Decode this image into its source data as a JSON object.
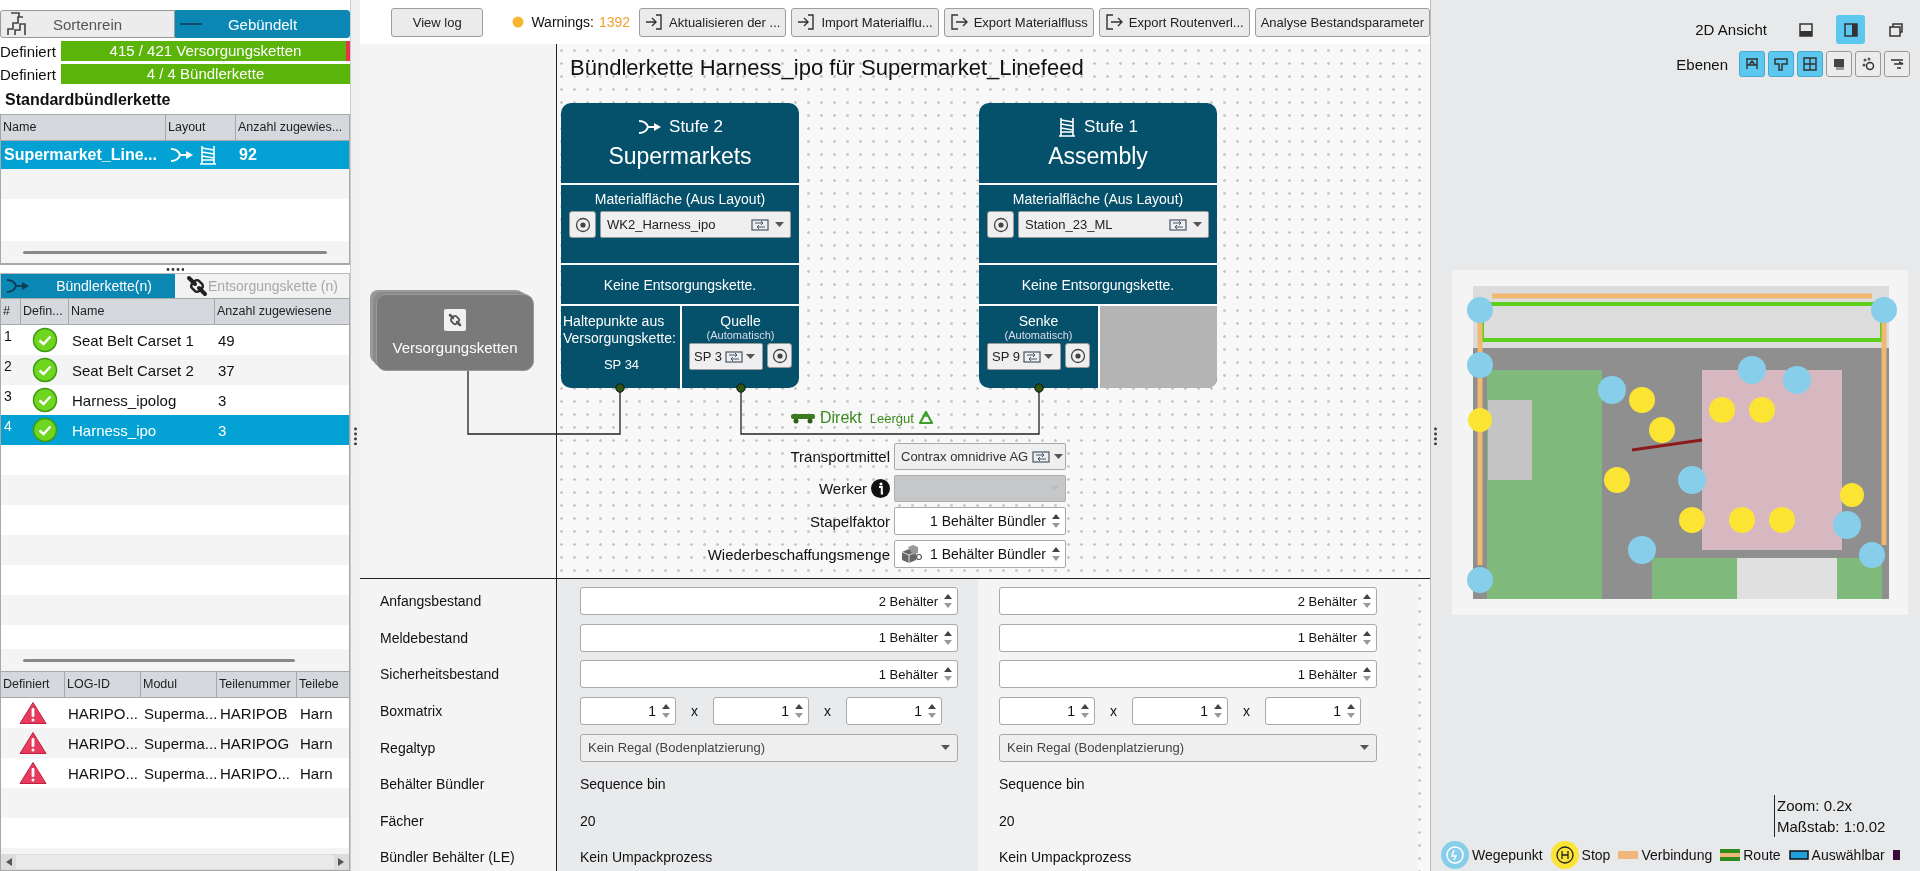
{
  "mode_toggle": [
    {
      "label": "Sortenrein",
      "selected": false
    },
    {
      "label": "Gebündelt",
      "selected": true
    }
  ],
  "progress": [
    {
      "label": "Definiert",
      "text": "415 / 421 Versorgungsketten",
      "level": 0.986
    },
    {
      "label": "Definiert",
      "text": "4 / 4 Bündlerkette",
      "level": 1
    }
  ],
  "default_chain": {
    "title": "Standardbündlerkette",
    "columns": [
      "Name",
      "Layout",
      "Anzahl zugewies..."
    ],
    "rows": [
      {
        "name": "Supermarket_Line...",
        "count": "92",
        "selected": true
      }
    ]
  },
  "chain_tabs": [
    {
      "label": "Bündlerkette(n)",
      "selected": true,
      "disabled": false
    },
    {
      "label": "Entsorgungskette (n)",
      "selected": false,
      "disabled": true
    }
  ],
  "chains": {
    "columns": [
      "#",
      "Defin...",
      "Name",
      "Anzahl zugewiesene"
    ],
    "rows": [
      {
        "index": "1",
        "defined": true,
        "name": "Seat Belt Carset 1",
        "count": "49",
        "selected": false
      },
      {
        "index": "2",
        "defined": true,
        "name": "Seat Belt Carset 2",
        "count": "37",
        "selected": false
      },
      {
        "index": "3",
        "defined": true,
        "name": "Harness_ipolog",
        "count": "3",
        "selected": false
      },
      {
        "index": "4",
        "defined": true,
        "name": "Harness_ipo",
        "count": "3",
        "selected": true
      }
    ]
  },
  "parts": {
    "columns": [
      "Definiert",
      "LOG-ID",
      "Modul",
      "Teilenummer",
      "Teilebe"
    ],
    "rows": [
      {
        "defined": false,
        "log_id": "HARIPO...",
        "module": "Superma...",
        "part_number": "HARIPOB",
        "column_5": "Harn"
      },
      {
        "defined": false,
        "log_id": "HARIPO...",
        "module": "Superma...",
        "part_number": "HARIPOG",
        "column_5": "Harn"
      },
      {
        "defined": false,
        "log_id": "HARIPO...",
        "module": "Superma...",
        "part_number": "HARIPO...",
        "column_5": "Harn"
      }
    ]
  },
  "toolbar": {
    "view_log": "View log",
    "warnings_label": "Warnings:",
    "warnings_count": "1392",
    "buttons": [
      {
        "label": "Aktualisieren der ..."
      },
      {
        "label": "Import Materialflu..."
      },
      {
        "label": "Export Materialfluss"
      },
      {
        "label": "Export Routenverl..."
      },
      {
        "label": "Analyse Bestandsparameter"
      }
    ]
  },
  "diagram": {
    "title": "Bündlerkette Harness_ipo für Supermarket_Linefeed",
    "source_node": "Versorgungsketten",
    "stages": [
      {
        "kind": "supermarket",
        "stage": "Stufe 2",
        "name": "Supermarkets",
        "area_label": "Materialfläche (Aus Layout)",
        "area_value": "WK2_Harness_ipo",
        "disposal": "Keine Entsorgungskette.",
        "stops_label": "Haltepunkte aus Versorgungskette:",
        "stops_value": "SP 34",
        "port_label": "Quelle",
        "port_hint": "(Automatisch)",
        "port_value": "SP 3"
      },
      {
        "kind": "assembly",
        "stage": "Stufe 1",
        "name": "Assembly",
        "area_label": "Materialfläche (Aus Layout)",
        "area_value": "Station_23_ML",
        "disposal": "Keine Entsorgungskette.",
        "port_label": "Senke",
        "port_hint": "(Automatisch)",
        "port_value": "SP 9"
      }
    ],
    "connection": {
      "mode": "Direkt",
      "empties": "Leergut"
    },
    "transport_form": [
      {
        "label": "Transportmittel",
        "kind": "select",
        "value": "Contrax omnidrive AG",
        "disabled": false
      },
      {
        "label": "Werker",
        "kind": "select",
        "disabled": true
      },
      {
        "label": "Stapelfaktor",
        "kind": "spin",
        "value": "1 Behälter Bündler"
      },
      {
        "label": "Wiederbeschaffungsmenge",
        "kind": "spin",
        "value": "1 Behälter Bündler"
      }
    ]
  },
  "stock_form": [
    {
      "label": "Anfangsbestand",
      "kind": "spin",
      "values": [
        "2 Behälter",
        "2 Behälter"
      ]
    },
    {
      "label": "Meldebestand",
      "kind": "spin",
      "values": [
        "1 Behälter",
        "1 Behälter"
      ]
    },
    {
      "label": "Sicherheitsbestand",
      "kind": "spin",
      "values": [
        "1 Behälter",
        "1 Behälter"
      ]
    },
    {
      "label": "Boxmatrix",
      "kind": "matrix",
      "values": [
        {
          "cells": [
            "1",
            "1",
            "1"
          ],
          "separators": [
            "x",
            "x"
          ]
        },
        {
          "cells": [
            "1",
            "1",
            "1"
          ],
          "separators": [
            "x",
            "x"
          ]
        }
      ]
    },
    {
      "label": "Regaltyp",
      "kind": "select",
      "values": [
        "Kein Regal (Bodenplatzierung)",
        "Kein Regal (Bodenplatzierung)"
      ]
    },
    {
      "label": "Behälter Bündler",
      "kind": "text",
      "values": [
        "Sequence bin",
        "Sequence bin"
      ]
    },
    {
      "label": "Fächer",
      "kind": "text",
      "values": [
        "20",
        "20"
      ]
    },
    {
      "label": "Bündler Behälter (LE)",
      "kind": "text",
      "values": [
        "Kein Umpackprozess",
        "Kein Umpackprozess"
      ]
    }
  ],
  "view_panel": {
    "view_label": "2D Ansicht",
    "view_buttons": [
      {
        "selected": false
      },
      {
        "selected": true
      },
      {
        "selected": false
      }
    ],
    "layers_label": "Ebenen",
    "layer_buttons": [
      {
        "on": true
      },
      {
        "on": true
      },
      {
        "on": true
      },
      {
        "on": false
      },
      {
        "on": false
      },
      {
        "on": false
      }
    ],
    "zoom": "Zoom: 0.2x",
    "scale": "Maßstab: 1:0.02",
    "legend": [
      {
        "kind": "waypoint",
        "label": "Wegepunkt"
      },
      {
        "kind": "stop",
        "label": "Stop"
      },
      {
        "kind": "connection",
        "label": "Verbindung"
      },
      {
        "kind": "route",
        "label": "Route"
      },
      {
        "kind": "selectable",
        "label": "Auswählbar"
      },
      {
        "kind": "marker"
      }
    ]
  }
}
